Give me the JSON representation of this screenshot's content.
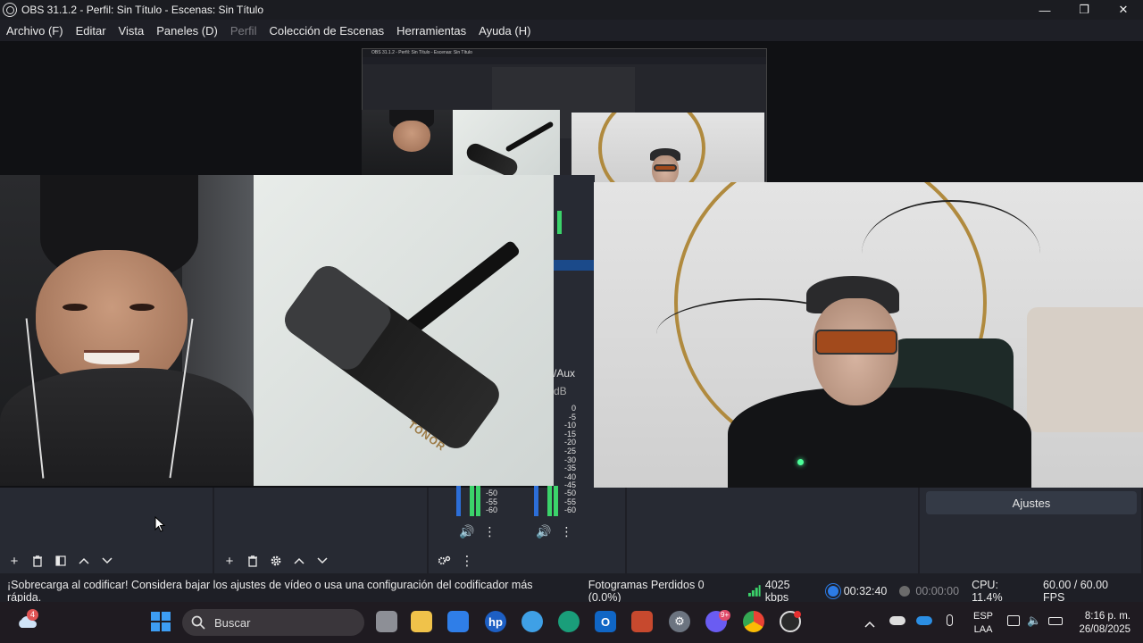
{
  "window": {
    "title": "OBS 31.1.2 - Perfil: Sin Título - Escenas: Sin Título",
    "min_glyph": "—",
    "max_glyph": "❐",
    "close_glyph": "✕"
  },
  "menu": {
    "items": [
      {
        "label": "Archivo (F)",
        "disabled": false
      },
      {
        "label": "Editar",
        "disabled": false
      },
      {
        "label": "Vista",
        "disabled": false
      },
      {
        "label": "Paneles (D)",
        "disabled": false
      },
      {
        "label": "Perfil",
        "disabled": true
      },
      {
        "label": "Colección de Escenas",
        "disabled": false
      },
      {
        "label": "Herramientas",
        "disabled": false
      },
      {
        "label": "Ayuda (H)",
        "disabled": false
      }
    ]
  },
  "preview": {
    "mixer_partial_label": "/Aux",
    "mixer_partial_db": "dB",
    "nested_title": "OBS 31.1.2 - Perfil: Sin Título - Escenas: Sin Título",
    "mic_brand": "TONOR"
  },
  "mixer": {
    "scale": [
      "-50",
      "-55",
      "-60"
    ],
    "scale_full": [
      "0",
      "-5",
      "-10",
      "-15",
      "-20",
      "-25",
      "-30",
      "-35",
      "-40",
      "-45",
      "-50",
      "-55",
      "-60"
    ]
  },
  "controls": {
    "settings_label": "Ajustes"
  },
  "statusbar": {
    "warning": "¡Sobrecarga al codificar! Considera bajar los ajustes de vídeo o usa una configuración del codificador más rápida.",
    "dropped_frames": "Fotogramas Perdidos 0 (0.0%)",
    "bitrate": "4025 kbps",
    "stream_time": "00:32:40",
    "record_time": "00:00:00",
    "cpu": "CPU: 11.4%",
    "fps": "60.00 / 60.00 FPS",
    "colors": {
      "bitrate": "#3bd36a",
      "stream": "#2c7be5",
      "record": "#6b6b6b"
    }
  },
  "taskbar": {
    "search_placeholder": "Buscar",
    "weather_badge": "4",
    "discord_badge": "9+",
    "lang_top": "ESP",
    "lang_bottom": "LAA",
    "time": "8:16 p. m.",
    "date": "26/08/2025",
    "icons": [
      "start-icon",
      "search-icon",
      "task-view-icon",
      "file-explorer-icon",
      "store-icon",
      "hp-icon",
      "browser-icon",
      "edge-icon",
      "outlook-icon",
      "office-icon",
      "settings-icon",
      "discord-icon",
      "chrome-icon",
      "obs-icon"
    ]
  }
}
